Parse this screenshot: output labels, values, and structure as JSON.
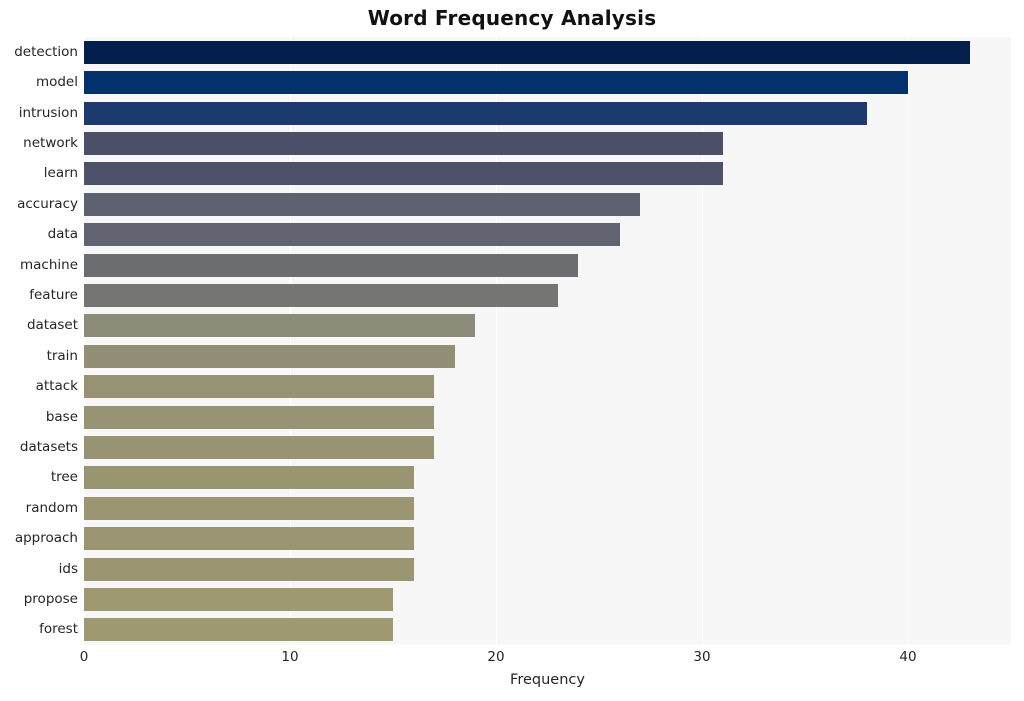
{
  "chart_data": {
    "type": "bar",
    "orientation": "horizontal",
    "title": "Word Frequency Analysis",
    "xlabel": "Frequency",
    "ylabel": "",
    "xlim": [
      0,
      45
    ],
    "ylim": [
      0,
      20
    ],
    "grid": true,
    "grid_axis": "x",
    "legend": null,
    "legend_position": "none",
    "xticks": [
      0,
      10,
      20,
      30,
      40
    ],
    "xtick_labels": [
      "0",
      "10",
      "20",
      "30",
      "40"
    ],
    "categories": [
      "detection",
      "model",
      "intrusion",
      "network",
      "learn",
      "accuracy",
      "data",
      "machine",
      "feature",
      "dataset",
      "train",
      "attack",
      "base",
      "datasets",
      "tree",
      "random",
      "approach",
      "ids",
      "propose",
      "forest"
    ],
    "values": [
      43,
      40,
      38,
      31,
      31,
      27,
      26,
      24,
      23,
      19,
      18,
      17,
      17,
      17,
      16,
      16,
      16,
      16,
      15,
      15
    ],
    "bar_colors": [
      "#03204d",
      "#04306c",
      "#1d3a6e",
      "#4b5068",
      "#4d5169",
      "#5d6170",
      "#616470",
      "#6b6d70",
      "#757573",
      "#8d8b79",
      "#938f77",
      "#979274",
      "#989373",
      "#989373",
      "#9a9571",
      "#9b9671",
      "#9b9671",
      "#9b9671",
      "#9e9970",
      "#9e9970"
    ],
    "plot_background": "#f7f7f7",
    "figure_background": "#ffffff",
    "gridline_color": "#ffffff",
    "tick_label_color": "#262626",
    "title_color": "#111111"
  }
}
